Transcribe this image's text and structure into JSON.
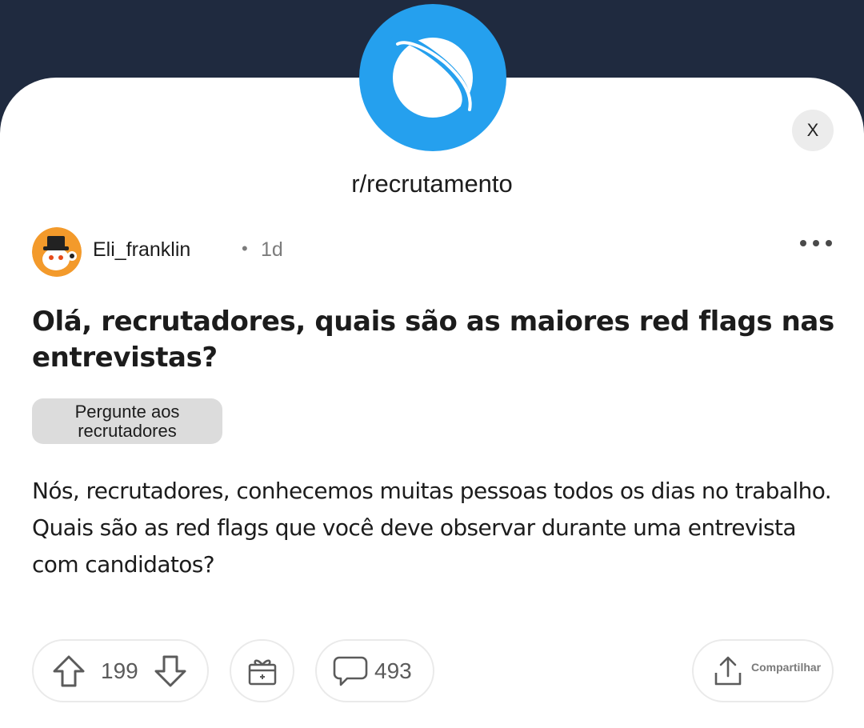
{
  "header": {
    "subreddit_icon": "planet-icon",
    "close_label": "X",
    "subreddit_name": "r/recrutamento"
  },
  "post": {
    "author": "Eli_franklin",
    "separator": "•",
    "age": "1d",
    "title": "Olá, recrutadores, quais são as maiores red flags nas entrevistas?",
    "flair": "Pergunte aos recrutadores",
    "body": "Nós, recrutadores, conhecemos muitas pessoas todos os dias no trabalho. Quais são as red flags que você deve observar durante uma entrevista com candidatos?"
  },
  "actions": {
    "upvotes": "199",
    "comments": "493",
    "share_label": "Compartilhar"
  },
  "colors": {
    "top_bar": "#1f2a3f",
    "subreddit_accent": "#25a0ee",
    "flair_bg": "#dcdcdc",
    "avatar_orange": "#f39a2b"
  }
}
